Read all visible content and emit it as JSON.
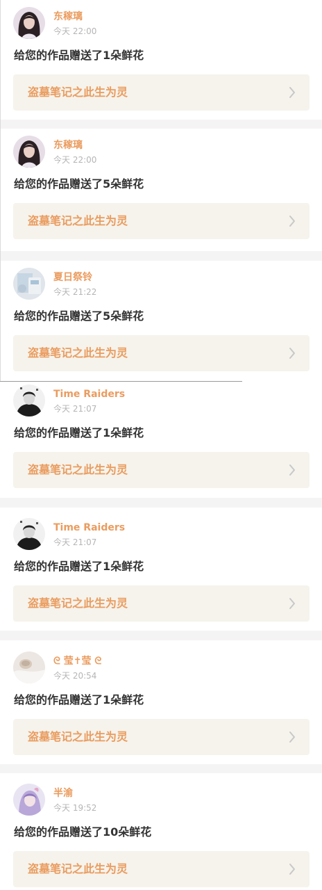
{
  "colors": {
    "accent": "#ea9c5f",
    "message_text": "#333333",
    "time_text": "#b5b5b5",
    "link_bg": "#f5f3ec",
    "separator": "#f5f4f4",
    "chevron": "#c8c8c8"
  },
  "notifications": [
    {
      "user": "东稼璃",
      "time": "今天 22:00",
      "message": "给您的作品赠送了1朵鲜花",
      "work_title": "盗墓笔记之此生为灵",
      "avatar_icon": "woman-portrait-avatar-icon"
    },
    {
      "user": "东稼璃",
      "time": "今天 22:00",
      "message": "给您的作品赠送了5朵鲜花",
      "work_title": "盗墓笔记之此生为灵",
      "avatar_icon": "woman-portrait-avatar-icon"
    },
    {
      "user": "夏日祭铃",
      "time": "今天 21:22",
      "message": "给您的作品赠送了5朵鲜花",
      "work_title": "盗墓笔记之此生为灵",
      "avatar_icon": "light-blue-photo-avatar-icon"
    },
    {
      "user": "Time Raiders",
      "time": "今天 21:07",
      "message": "给您的作品赠送了1朵鲜花",
      "work_title": "盗墓笔记之此生为灵",
      "avatar_icon": "black-white-portrait-avatar-icon"
    },
    {
      "user": "Time Raiders",
      "time": "今天 21:07",
      "message": "给您的作品赠送了1朵鲜花",
      "work_title": "盗墓笔记之此生为灵",
      "avatar_icon": "black-white-portrait-avatar-icon"
    },
    {
      "user": "ᘓ 莹✝莹 ᘓ",
      "time": "今天 20:54",
      "message": "给您的作品赠送了1朵鲜花",
      "work_title": "盗墓笔记之此生为灵",
      "avatar_icon": "pale-blanket-photo-avatar-icon"
    },
    {
      "user": "半渝",
      "time": "今天 19:52",
      "message": "给您的作品赠送了10朵鲜花",
      "work_title": "盗墓笔记之此生为灵",
      "avatar_icon": "anime-character-avatar-icon"
    }
  ]
}
